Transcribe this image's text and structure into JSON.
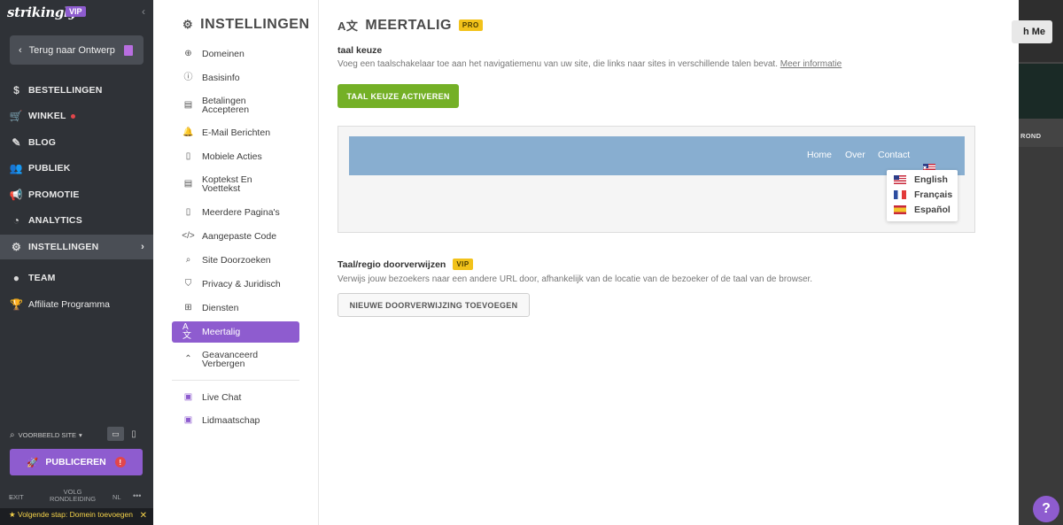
{
  "app": {
    "logo": "strikingly",
    "vip_badge": "VIP",
    "collapse": "‹"
  },
  "sidebar": {
    "back_label": "Terug naar Ontwerp",
    "items": [
      {
        "label": "BESTELLINGEN",
        "icon": "dollar-icon"
      },
      {
        "label": "WINKEL",
        "icon": "cart-icon",
        "dot": true
      },
      {
        "label": "BLOG",
        "icon": "pen-icon"
      },
      {
        "label": "PUBLIEK",
        "icon": "people-icon"
      },
      {
        "label": "PROMOTIE",
        "icon": "megaphone-icon"
      },
      {
        "label": "ANALYTICS",
        "icon": "pie-chart-icon"
      },
      {
        "label": "INSTELLINGEN",
        "icon": "gear-icon",
        "active": true
      },
      {
        "label": "TEAM",
        "icon": "team-icon"
      },
      {
        "label": "Affiliate Programma",
        "icon": "trophy-icon"
      }
    ],
    "preview_label": "VOORBEELD SITE",
    "publish_label": "PUBLICEREN",
    "publish_alert": "!",
    "bottom": {
      "exit": "EXIT",
      "tour": "VOLG RONDLEIDING",
      "lang": "NL",
      "more": "•••"
    },
    "next_step": "Volgende stap: Domein toevoegen"
  },
  "settings": {
    "title": "INSTELLINGEN",
    "items": [
      {
        "label": "Domeinen",
        "icon": "globe-icon"
      },
      {
        "label": "Basisinfo",
        "icon": "info-icon"
      },
      {
        "label": "Betalingen Accepteren",
        "icon": "card-icon"
      },
      {
        "label": "E-Mail Berichten",
        "icon": "bell-icon"
      },
      {
        "label": "Mobiele Acties",
        "icon": "mobile-icon"
      },
      {
        "label": "Koptekst En Voettekst",
        "icon": "layout-icon"
      },
      {
        "label": "Meerdere Pagina's",
        "icon": "pages-icon"
      },
      {
        "label": "Aangepaste Code",
        "icon": "code-icon"
      },
      {
        "label": "Site Doorzoeken",
        "icon": "search-icon"
      },
      {
        "label": "Privacy & Juridisch",
        "icon": "shield-icon"
      },
      {
        "label": "Diensten",
        "icon": "grid-icon"
      },
      {
        "label": "Meertalig",
        "icon": "translate-icon",
        "active": true
      },
      {
        "label": "Geavanceerd Verbergen",
        "icon": "chevron-up-icon"
      },
      {
        "label": "Live Chat",
        "icon": "chat-icon"
      },
      {
        "label": "Lidmaatschap",
        "icon": "member-icon"
      }
    ]
  },
  "main": {
    "title": "MEERTALIG",
    "title_badge": "PRO",
    "lang_section": {
      "label": "taal keuze",
      "description": "Voeg een taalschakelaar toe aan het navigatiemenu van uw site, die links naar sites in verschillende talen bevat.",
      "more_link": "Meer informatie",
      "button": "TAAL KEUZE ACTIVEREN"
    },
    "preview": {
      "nav_links": [
        "Home",
        "Over",
        "Contact"
      ],
      "dropdown_arrow": "▾",
      "languages": [
        {
          "label": "English",
          "flag": "us-flag-icon"
        },
        {
          "label": "Français",
          "flag": "fr-flag-icon"
        },
        {
          "label": "Español",
          "flag": "es-flag-icon"
        }
      ]
    },
    "redirect_section": {
      "label": "Taal/regio doorverwijzen",
      "badge": "VIP",
      "description": "Verwijs jouw bezoekers naar een andere URL door, afhankelijk van de locatie van de bezoeker of de taal van de browser.",
      "button": "NIEUWE DOORVERWIJZING TOEVOEGEN"
    }
  },
  "right_panel": {
    "button": "h Me",
    "label": "ROND"
  },
  "help": "?",
  "colors": {
    "accent": "#8e5ccf",
    "green": "#74b026",
    "badge": "#f2c21a",
    "sidebar_bg": "#2f3237"
  }
}
